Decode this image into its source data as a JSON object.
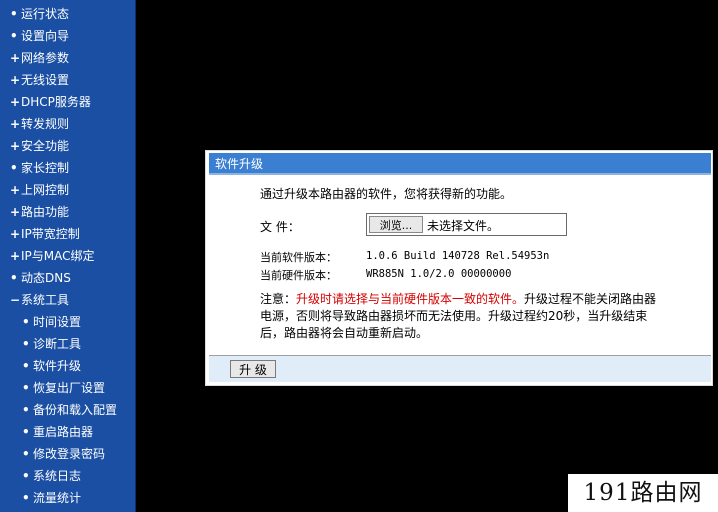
{
  "sidebar": {
    "items": [
      {
        "marker": "•",
        "label": "运行状态"
      },
      {
        "marker": "•",
        "label": "设置向导"
      },
      {
        "marker": "+",
        "label": "网络参数"
      },
      {
        "marker": "+",
        "label": "无线设置"
      },
      {
        "marker": "+",
        "label": "DHCP服务器"
      },
      {
        "marker": "+",
        "label": "转发规则"
      },
      {
        "marker": "+",
        "label": "安全功能"
      },
      {
        "marker": "•",
        "label": "家长控制"
      },
      {
        "marker": "+",
        "label": "上网控制"
      },
      {
        "marker": "+",
        "label": "路由功能"
      },
      {
        "marker": "+",
        "label": "IP带宽控制"
      },
      {
        "marker": "+",
        "label": "IP与MAC绑定"
      },
      {
        "marker": "•",
        "label": "动态DNS"
      },
      {
        "marker": "−",
        "label": "系统工具"
      }
    ],
    "sub_items": [
      {
        "marker": "•",
        "label": "时间设置"
      },
      {
        "marker": "•",
        "label": "诊断工具"
      },
      {
        "marker": "•",
        "label": "软件升级"
      },
      {
        "marker": "•",
        "label": "恢复出厂设置"
      },
      {
        "marker": "•",
        "label": "备份和载入配置"
      },
      {
        "marker": "•",
        "label": "重启路由器"
      },
      {
        "marker": "•",
        "label": "修改登录密码"
      },
      {
        "marker": "•",
        "label": "系统日志"
      },
      {
        "marker": "•",
        "label": "流量统计"
      }
    ]
  },
  "panel": {
    "title": "软件升级",
    "intro": "通过升级本路由器的软件，您将获得新的功能。",
    "file_label": "文 件：",
    "browse_button": "浏览...",
    "file_status": "未选择文件。",
    "software_version_label": "当前软件版本：",
    "software_version": "1.0.6 Build 140728 Rel.54953n",
    "hardware_version_label": "当前硬件版本：",
    "hardware_version": "WR885N 1.0/2.0 00000000",
    "notice_prefix": "注意：",
    "notice_warning": "升级时请选择与当前硬件版本一致的软件。",
    "notice_rest": "升级过程不能关闭路由器电源，否则将导致路由器损坏而无法使用。升级过程约20秒，当升级结束后，路由器将会自动重新启动。",
    "upgrade_button": "升 级"
  },
  "watermark": "191路由网"
}
